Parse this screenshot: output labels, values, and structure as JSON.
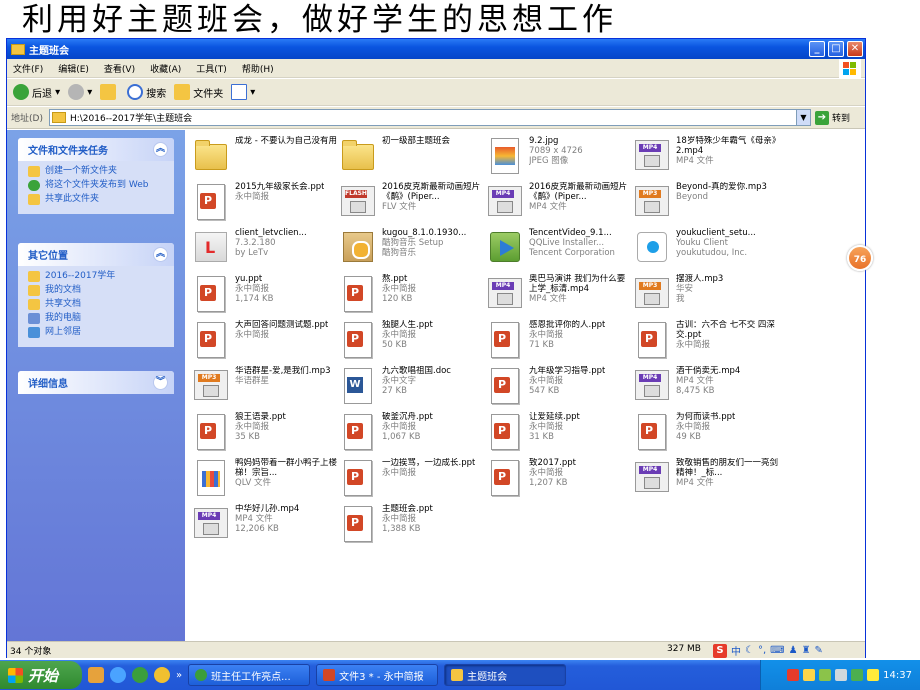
{
  "slide": {
    "title": "利用好主题班会，做好学生的思想工作"
  },
  "window": {
    "title": "主题班会"
  },
  "menu": [
    "文件(F)",
    "编辑(E)",
    "查看(V)",
    "收藏(A)",
    "工具(T)",
    "帮助(H)"
  ],
  "toolbar": {
    "back": "后退",
    "search": "搜索",
    "folders": "文件夹"
  },
  "address": {
    "label": "地址(D)",
    "path": "H:\\2016--2017学年\\主题班会",
    "go": "转到"
  },
  "sidebar": {
    "tasks": {
      "title": "文件和文件夹任务",
      "items": [
        "创建一个新文件夹",
        "将这个文件夹发布到 Web",
        "共享此文件夹"
      ]
    },
    "places": {
      "title": "其它位置",
      "items": [
        "2016--2017学年",
        "我的文档",
        "共享文档",
        "我的电脑",
        "网上邻居"
      ]
    },
    "details": {
      "title": "详细信息"
    }
  },
  "files": [
    {
      "name": "成龙 - 不要认为自己没有用",
      "l2": "",
      "l3": "",
      "type": "folder"
    },
    {
      "name": "初一级部主题班会",
      "l2": "",
      "l3": "",
      "type": "folder"
    },
    {
      "name": "9.2.jpg",
      "l2": "7089 x 4726",
      "l3": "JPEG 图像",
      "type": "jpg"
    },
    {
      "name": "18岁特殊少年霸气《母亲》2.mp4",
      "l2": "MP4 文件",
      "l3": "",
      "type": "mp4"
    },
    {
      "name": "2015九年级家长会.ppt",
      "l2": "永中简报",
      "l3": "",
      "type": "ppt"
    },
    {
      "name": "2016皮克斯最新动画短片《鹬》(Piper...",
      "l2": "FLV 文件",
      "l3": "",
      "type": "flash"
    },
    {
      "name": "2016皮克斯最新动画短片《鹬》(Piper...",
      "l2": "MP4 文件",
      "l3": "",
      "type": "mp4"
    },
    {
      "name": "Beyond-真的爱你.mp3",
      "l2": "Beyond",
      "l3": "",
      "type": "mp3"
    },
    {
      "name": "client_letvclien...",
      "l2": "7.3.2.180",
      "l3": "by LeTv",
      "type": "letv"
    },
    {
      "name": "kugou_8.1.0.1930...",
      "l2": "酷狗音乐 Setup",
      "l3": "酷狗音乐",
      "type": "box"
    },
    {
      "name": "TencentVideo_9.1...",
      "l2": "QQLive Installer...",
      "l3": "Tencent Corporation",
      "type": "tencent"
    },
    {
      "name": "youkuclient_setu...",
      "l2": "Youku Client",
      "l3": "youkutudou, Inc.",
      "type": "youku"
    },
    {
      "name": "yu.ppt",
      "l2": "永中简报",
      "l3": "1,174 KB",
      "type": "ppt"
    },
    {
      "name": "熬.ppt",
      "l2": "永中简报",
      "l3": "120 KB",
      "type": "ppt"
    },
    {
      "name": "奥巴马演讲 我们为什么要上学_标清.mp4",
      "l2": "MP4 文件",
      "l3": "",
      "type": "mp4"
    },
    {
      "name": "摆渡人.mp3",
      "l2": "华安",
      "l3": "我",
      "type": "mp3"
    },
    {
      "name": "大声回答问题测试题.ppt",
      "l2": "永中简报",
      "l3": "",
      "type": "ppt"
    },
    {
      "name": "独腿人生.ppt",
      "l2": "永中简报",
      "l3": "50 KB",
      "type": "ppt"
    },
    {
      "name": "感恩批评你的人.ppt",
      "l2": "永中简报",
      "l3": "71 KB",
      "type": "ppt"
    },
    {
      "name": "古训：六不合 七不交 四深交.ppt",
      "l2": "永中简报",
      "l3": "",
      "type": "ppt"
    },
    {
      "name": "华语群星-爱,是我们.mp3",
      "l2": "华语群星",
      "l3": "",
      "type": "mp3"
    },
    {
      "name": "九六歌唱祖国.doc",
      "l2": "永中文字",
      "l3": "27 KB",
      "type": "doc"
    },
    {
      "name": "九年级学习指导.ppt",
      "l2": "永中简报",
      "l3": "547 KB",
      "type": "ppt"
    },
    {
      "name": "酒干倘卖无.mp4",
      "l2": "MP4 文件",
      "l3": "8,475 KB",
      "type": "mp4"
    },
    {
      "name": "狼王语录.ppt",
      "l2": "永中简报",
      "l3": "35 KB",
      "type": "ppt"
    },
    {
      "name": "破釜沉舟.ppt",
      "l2": "永中简报",
      "l3": "1,067 KB",
      "type": "ppt"
    },
    {
      "name": "让爱延续.ppt",
      "l2": "永中简报",
      "l3": "31 KB",
      "type": "ppt"
    },
    {
      "name": "为何而读书.ppt",
      "l2": "永中简报",
      "l3": "49 KB",
      "type": "ppt"
    },
    {
      "name": "鸭妈妈带着一群小鸭子上楼梯！宗旨...",
      "l2": "QLV 文件",
      "l3": "",
      "type": "qlv"
    },
    {
      "name": "一边挨骂，一边成长.ppt",
      "l2": "永中简报",
      "l3": "",
      "type": "ppt"
    },
    {
      "name": "致2017.ppt",
      "l2": "永中简报",
      "l3": "1,207 KB",
      "type": "ppt"
    },
    {
      "name": "致敬销售的朋友们一一亮剑精神！_标...",
      "l2": "MP4 文件",
      "l3": "",
      "type": "mp4"
    },
    {
      "name": "中华好儿孙.mp4",
      "l2": "MP4 文件",
      "l3": "12,206 KB",
      "type": "mp4"
    },
    {
      "name": "主题班会.ppt",
      "l2": "永中简报",
      "l3": "1,388 KB",
      "type": "ppt"
    }
  ],
  "status": {
    "count": "34 个对象",
    "size": "327 MB",
    "ime": "中"
  },
  "taskbar": {
    "start": "开始",
    "tasks": [
      "班主任工作亮点...",
      "文件3 * - 永中简报",
      "主题班会"
    ],
    "clock": "14:37"
  },
  "badge": "76"
}
